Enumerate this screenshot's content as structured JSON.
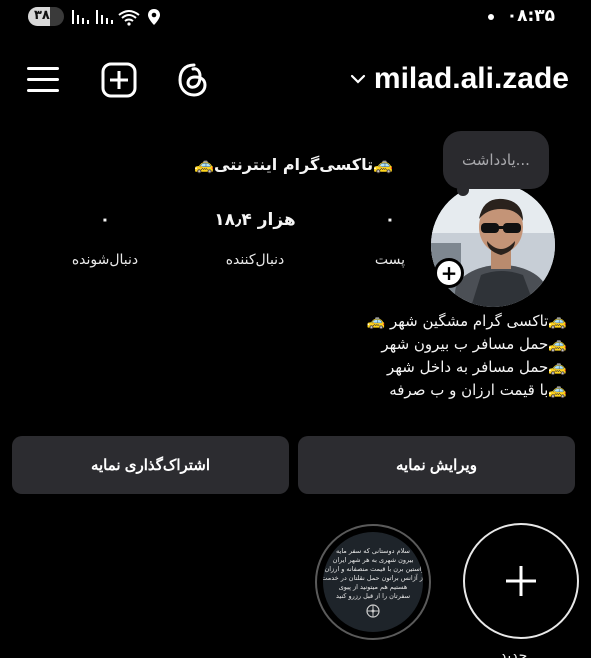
{
  "status_bar": {
    "battery_level": "۳۸",
    "clock": "۰۸:۳۵"
  },
  "nav": {
    "username": "milad.ali.zade"
  },
  "profile": {
    "note_placeholder": "یادداشت...",
    "display_name": "🚕تاکسی‌گرام اینترنتی🚕",
    "stats": {
      "posts_value": "۰",
      "posts_label": "پست",
      "followers_value": "۱۸٫۴ هزار",
      "followers_label": "دنبال‌کننده",
      "following_value": "۰",
      "following_label": "دنبال‌شونده"
    },
    "bio_lines": [
      "🚕تاکسی گرام مشگین شهر 🚕",
      "🚕حمل مسافر ب بیرون شهر",
      "🚕حمل مسافر به داخل شهر",
      "🚕با قیمت ارزان و ب صرفه"
    ]
  },
  "buttons": {
    "edit_profile": "ویرایش نمایه",
    "share_profile": "اشتراک‌گذاری نمایه"
  },
  "highlights": {
    "story_text_lines": [
      "سلام دوستانی که سفر مایه",
      "بیرون شهری به هر شهر ایران",
      "خواستین برن با قیمت منصفانه و ارزان تر",
      "از آژانس براتون حمل نقلتان در خدمت",
      "هستیم هم میتونید از پیوی",
      "سفرتان را از قبل رزرو کنید"
    ],
    "new_label": "جدید"
  },
  "colors": {
    "background": "#000000",
    "button_bg": "#2c2c30",
    "note_bg": "#2a2a2e"
  }
}
